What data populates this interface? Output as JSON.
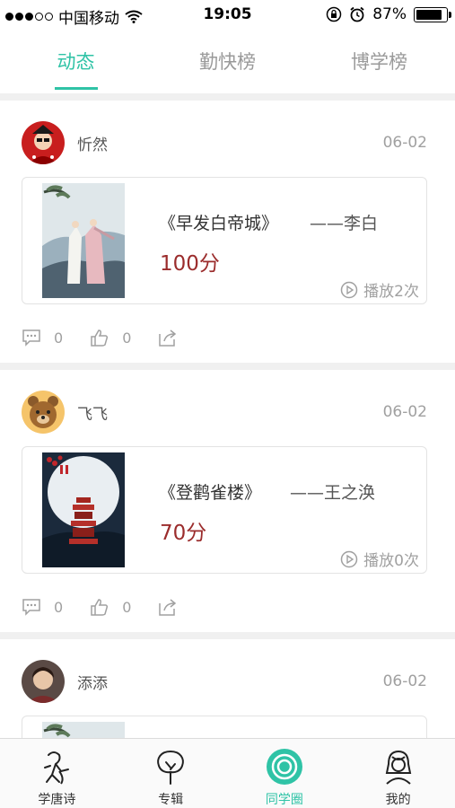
{
  "status_bar": {
    "carrier": "中国移动",
    "time": "19:05",
    "battery_pct": "87%",
    "battery_level": 0.87
  },
  "tabs": [
    {
      "label": "动态",
      "active": true
    },
    {
      "label": "勤快榜",
      "active": false
    },
    {
      "label": "博学榜",
      "active": false
    }
  ],
  "posts": [
    {
      "author": "忻然",
      "date": "06-02",
      "poem_title": "《早发白帝城》",
      "poem_author": "——李白",
      "score": "100分",
      "plays": "播放2次",
      "comments": "0",
      "likes": "0"
    },
    {
      "author": "飞飞",
      "date": "06-02",
      "poem_title": "《登鹳雀楼》",
      "poem_author": "——王之涣",
      "score": "70分",
      "plays": "播放0次",
      "comments": "0",
      "likes": "0"
    },
    {
      "author": "添添",
      "date": "06-02"
    }
  ],
  "bottom_nav": [
    {
      "label": "学唐诗",
      "icon": "poet-icon",
      "active": false
    },
    {
      "label": "专辑",
      "icon": "tree-icon",
      "active": false
    },
    {
      "label": "同学圈",
      "icon": "circle-icon",
      "active": true
    },
    {
      "label": "我的",
      "icon": "profile-icon",
      "active": false
    }
  ],
  "colors": {
    "accent": "#2fc3a6",
    "score": "#9b2c2c",
    "muted": "#a0a0a0"
  }
}
